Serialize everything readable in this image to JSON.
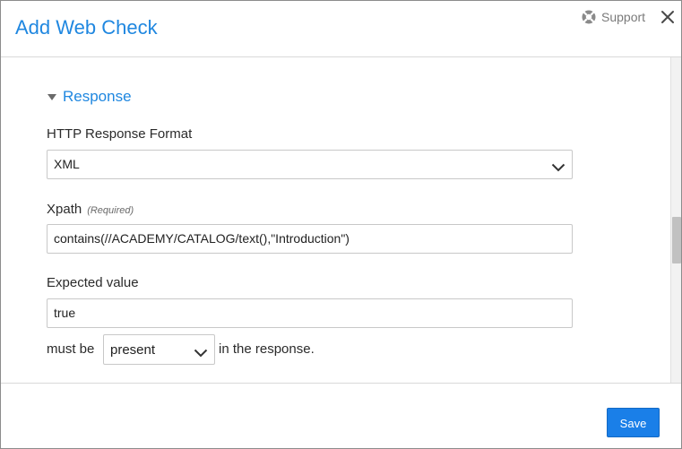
{
  "header": {
    "title": "Add Web Check",
    "support_label": "Support",
    "support_icon": "lifebuoy-icon",
    "close_icon": "close-icon"
  },
  "response_section": {
    "toggle_label": "Response",
    "expanded": true
  },
  "form": {
    "format": {
      "label": "HTTP Response Format",
      "selected": "XML"
    },
    "xpath": {
      "label": "Xpath",
      "required_note": "(Required)",
      "value": "contains(//ACADEMY/CATALOG/text(),\"Introduction\")"
    },
    "expected": {
      "label": "Expected value",
      "value": "true"
    },
    "presence": {
      "prefix": "must be",
      "selected": "present",
      "suffix": "in the response."
    }
  },
  "footer": {
    "save_label": "Save"
  },
  "colors": {
    "accent": "#1f87e0",
    "button": "#1a7fe8"
  }
}
